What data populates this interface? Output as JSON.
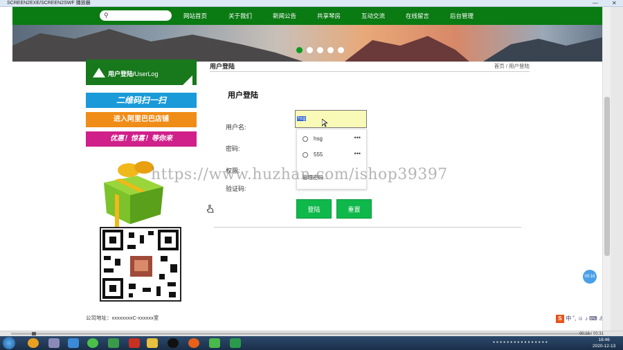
{
  "window": {
    "title": "SCREEN2EXE/SCREEN2SWF 播放器",
    "minimize": "—",
    "close": "✕"
  },
  "nav": {
    "items": [
      "网站首页",
      "关于我们",
      "新闻公告",
      "共享琴房",
      "互动交流",
      "在线留言",
      "后台管理"
    ]
  },
  "sidebar": {
    "heading": "用户登陆/",
    "heading_en": "UserLog",
    "ad_lines": [
      "二维码扫一扫",
      "进入阿里巴巴店铺",
      "优惠！惊喜！等你来"
    ],
    "address": "公司地址：xxxxxxxxC-xxxxxx室"
  },
  "content": {
    "header": "用户登陆",
    "breadcrumb": "首页 / 用户登陆",
    "form_title": "用户登陆",
    "username_label": "用户名:",
    "username_value": "hsg",
    "password_label": "密码:",
    "role_label": "权限:",
    "captcha_label": "验证码:",
    "autocomplete": [
      {
        "name": "hsg",
        "more": "•••"
      },
      {
        "name": "555",
        "more": "•••"
      }
    ],
    "autocomplete_manage": "管理密码...",
    "login_button": "登陆",
    "reset_button": "重置"
  },
  "watermark": "https://www.huzhan.com/ishop39397",
  "timer": "00:16",
  "ime": {
    "logo": "S",
    "items": "中 ˚, ☺ ♪ ⌨ ♙ ⋯"
  },
  "player": {
    "time": "00:16 / 00:31"
  },
  "clock": {
    "time": "18:46",
    "date": "2020-12-13"
  },
  "colors": {
    "nav_green": "#0a7a12",
    "button_green": "#0fb84a",
    "input_yellow": "#f9f9b8"
  }
}
